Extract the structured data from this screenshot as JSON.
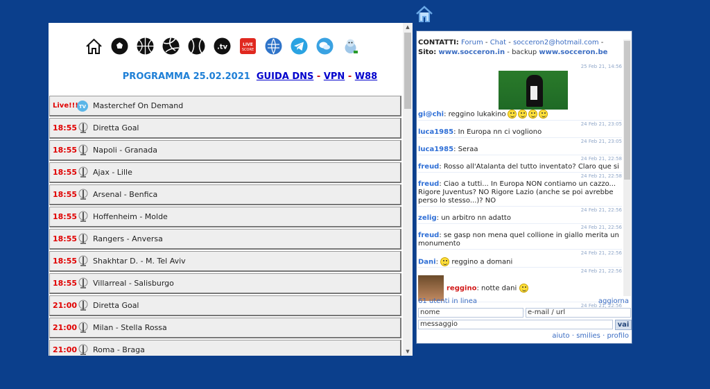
{
  "top_icon": "home-icon",
  "left": {
    "icons": [
      "home-icon",
      "soccer-ball-icon",
      "basketball-icon",
      "volleyball-icon",
      "tennis-ball-icon",
      "tv-icon",
      "live-score-icon",
      "globe-icon",
      "telegram-icon",
      "chat-bubbles-icon",
      "mascot-icon"
    ],
    "live_score_label": "LIVE SCORE",
    "tv_label": ".tv",
    "programma": "PROGRAMMA 25.02.2021",
    "links": [
      "GUIDA DNS",
      "VPN",
      "W88"
    ],
    "dash": "-",
    "live_label": "Live!!!",
    "rows": [
      {
        "time": "",
        "name": "Masterchef On Demand"
      },
      {
        "time": "18:55",
        "name": "Diretta Goal"
      },
      {
        "time": "18:55",
        "name": "Napoli - Granada"
      },
      {
        "time": "18:55",
        "name": "Ajax - Lille"
      },
      {
        "time": "18:55",
        "name": "Arsenal - Benfica"
      },
      {
        "time": "18:55",
        "name": "Hoffenheim - Molde"
      },
      {
        "time": "18:55",
        "name": "Rangers - Anversa"
      },
      {
        "time": "18:55",
        "name": "Shakhtar D. - M. Tel Aviv"
      },
      {
        "time": "18:55",
        "name": "Villarreal - Salisburgo"
      },
      {
        "time": "21:00",
        "name": "Diretta Goal"
      },
      {
        "time": "21:00",
        "name": "Milan - Stella Rossa"
      },
      {
        "time": "21:00",
        "name": "Roma - Braga"
      }
    ]
  },
  "chat": {
    "contatti": "CONTATTI:",
    "forum": "Forum",
    "chat_link": "Chat",
    "email": "socceron2@hotmail.com",
    "sito": "Sito:",
    "site1": "www.socceron.in",
    "backup": "backup",
    "site2": "www.socceron.be",
    "sep": "-",
    "messages": [
      {
        "ts": "25 Feb 21, 14:56",
        "user": "gi@chi",
        "text": "reggino lukakino"
      },
      {
        "ts": "24 Feb 21, 23:05",
        "user": "luca1985",
        "text": "In Europa nn ci vogliono"
      },
      {
        "ts": "24 Feb 21, 23:05",
        "user": "luca1985",
        "text": "Seraa"
      },
      {
        "ts": "24 Feb 21, 22:58",
        "user": "freud",
        "text": "Rosso all'Atalanta del tutto inventato? Claro que si"
      },
      {
        "ts": "24 Feb 21, 22:58",
        "user": "freud",
        "text": "Ciao a tutti... In Europa NON contiamo un cazzo... Rigore Juventus? NO Rigore Lazio (anche se poi avrebbe perso lo stesso...)? NO"
      },
      {
        "ts": "24 Feb 21, 22:56",
        "user": "zelig",
        "text": "un arbitro nn adatto"
      },
      {
        "ts": "24 Feb 21, 22:56",
        "user": "freud",
        "text": "se gasp non mena quel collione in giallo merita un monumento"
      },
      {
        "ts": "24 Feb 21, 22:56",
        "user": "Dani",
        "text": "reggino a domani"
      },
      {
        "ts": "24 Feb 21, 22:56",
        "user": "reggino",
        "text": "notte dani"
      },
      {
        "ts": "24 Feb 21, 22:56",
        "user": "",
        "text": ""
      }
    ],
    "users_online": "61 utenti in linea",
    "refresh": "aggiorna",
    "name_placeholder": "nome",
    "email_placeholder": "e-mail / url",
    "message_placeholder": "messaggio",
    "send": "vai",
    "aiuto": "aiuto",
    "smilies": "smilies",
    "profilo": "profilo",
    "dot": "·"
  },
  "colors": {
    "background": "#0b3f8c",
    "time_red": "#e00000",
    "link_blue": "#2f6fd6"
  }
}
